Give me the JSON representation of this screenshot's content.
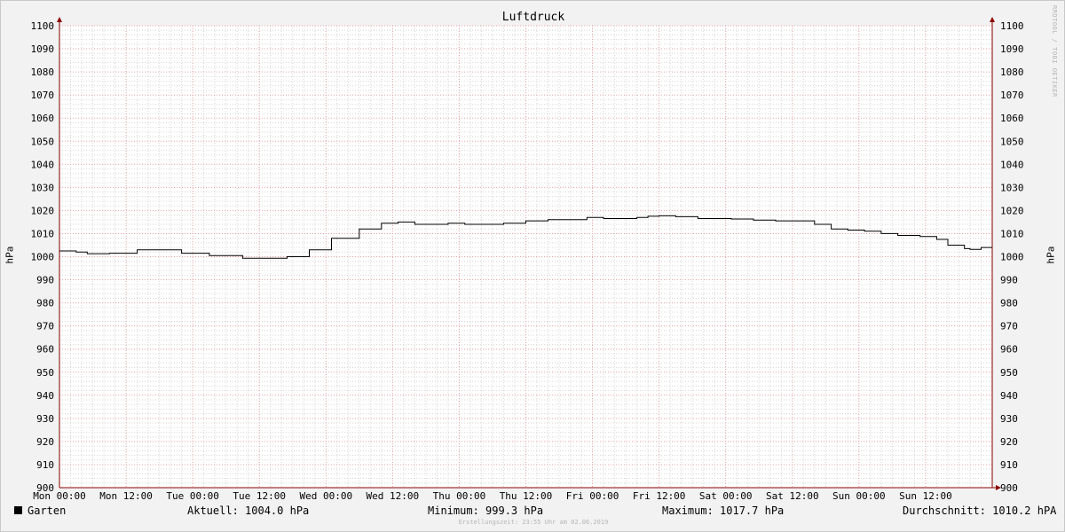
{
  "chart_data": {
    "type": "line",
    "title": "Luftdruck",
    "ylabel": "hPa",
    "ylim": [
      900,
      1100
    ],
    "yticks": [
      900,
      910,
      920,
      930,
      940,
      950,
      960,
      970,
      980,
      990,
      1000,
      1010,
      1020,
      1030,
      1040,
      1050,
      1060,
      1070,
      1080,
      1090,
      1100
    ],
    "xlim_hours": [
      0,
      168
    ],
    "xticks": [
      {
        "h": 0,
        "label": "Mon 00:00"
      },
      {
        "h": 12,
        "label": "Mon 12:00"
      },
      {
        "h": 24,
        "label": "Tue 00:00"
      },
      {
        "h": 36,
        "label": "Tue 12:00"
      },
      {
        "h": 48,
        "label": "Wed 00:00"
      },
      {
        "h": 60,
        "label": "Wed 12:00"
      },
      {
        "h": 72,
        "label": "Thu 00:00"
      },
      {
        "h": 84,
        "label": "Thu 12:00"
      },
      {
        "h": 96,
        "label": "Fri 00:00"
      },
      {
        "h": 108,
        "label": "Fri 12:00"
      },
      {
        "h": 120,
        "label": "Sat 00:00"
      },
      {
        "h": 132,
        "label": "Sat 12:00"
      },
      {
        "h": 144,
        "label": "Sun 00:00"
      },
      {
        "h": 156,
        "label": "Sun 12:00"
      }
    ],
    "grid": true,
    "legend_position": "bottom-left",
    "series": [
      {
        "name": "Garten",
        "color": "#000000",
        "x": [
          0,
          3,
          5,
          9,
          14,
          18,
          22,
          27,
          29,
          33,
          37,
          41,
          45,
          49,
          54,
          58,
          61,
          64,
          67,
          70,
          73,
          76,
          80,
          84,
          88,
          92,
          95,
          98,
          101,
          104,
          106,
          108,
          111,
          115,
          118,
          121,
          125,
          129,
          133,
          136,
          139,
          142,
          145,
          148,
          151,
          155,
          158,
          160,
          163,
          164,
          166,
          168
        ],
        "y": [
          1002.5,
          1002.0,
          1001.3,
          1001.5,
          1003.0,
          1003.0,
          1001.5,
          1000.5,
          1000.5,
          999.3,
          999.3,
          1000.0,
          1003.0,
          1008.0,
          1012.0,
          1014.5,
          1015.0,
          1014.0,
          1014.0,
          1014.5,
          1014.0,
          1014.0,
          1014.5,
          1015.5,
          1016.0,
          1016.0,
          1017.0,
          1016.5,
          1016.5,
          1017.0,
          1017.5,
          1017.7,
          1017.3,
          1016.5,
          1016.5,
          1016.3,
          1015.8,
          1015.5,
          1015.5,
          1014.0,
          1012.0,
          1011.5,
          1011.0,
          1010.0,
          1009.2,
          1008.7,
          1007.5,
          1005.0,
          1003.5,
          1003.2,
          1004.0,
          1004.0
        ]
      }
    ]
  },
  "watermark": "RRDTOOL / TOBI OETIKER",
  "legend": {
    "series_label": "Garten",
    "current": "Aktuell: 1004.0 hPa",
    "minimum": "Minimum: 999.3 hPa",
    "maximum": "Maximum: 1017.7 hPa",
    "average": "Durchschnitt: 1010.2 hPA"
  },
  "footer": "Erstellungszeit: 23:55 Uhr am 02.06.2019",
  "colors": {
    "background": "#f2f2f2",
    "plot_background": "#ffffff",
    "minor_grid": "#d6d6d6",
    "major_grid": "#e5a0a0",
    "axis": "#8b0000",
    "line": "#000000"
  }
}
